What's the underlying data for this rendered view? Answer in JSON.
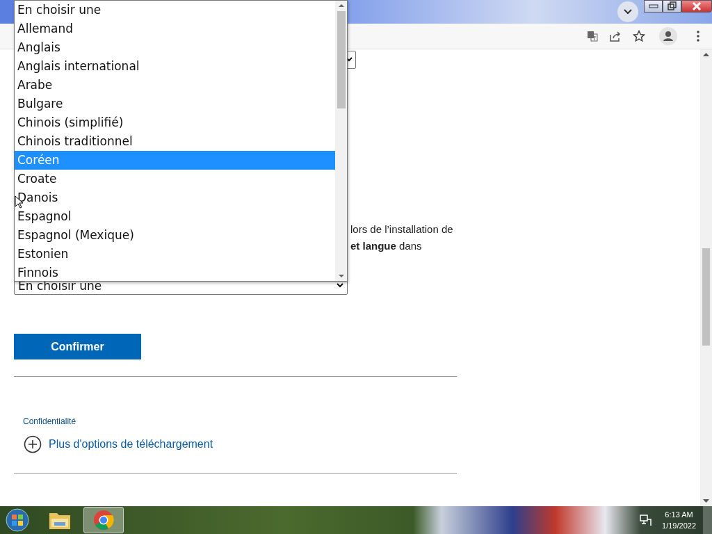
{
  "dropdown": {
    "options": [
      {
        "label": "En choisir une",
        "selected": false
      },
      {
        "label": "Allemand",
        "selected": false
      },
      {
        "label": "Anglais",
        "selected": false
      },
      {
        "label": "Anglais international",
        "selected": false
      },
      {
        "label": "Arabe",
        "selected": false
      },
      {
        "label": "Bulgare",
        "selected": false
      },
      {
        "label": "Chinois (simplifié)",
        "selected": false
      },
      {
        "label": "Chinois traditionnel",
        "selected": false
      },
      {
        "label": "Coréen",
        "selected": true
      },
      {
        "label": "Croate",
        "selected": false
      },
      {
        "label": "Danois",
        "selected": false
      },
      {
        "label": "Espagnol",
        "selected": false
      },
      {
        "label": "Espagnol (Mexique)",
        "selected": false
      },
      {
        "label": "Estonien",
        "selected": false
      },
      {
        "label": "Finnois",
        "selected": false
      }
    ]
  },
  "page": {
    "paragraph_lines": [
      "lors de l’installation de",
      "**et langue** dans"
    ],
    "language_select": {
      "value": "En choisir une"
    },
    "confirm_button": "Confirmer",
    "privacy_link": "Confidentialité",
    "more_options": "Plus d'options de téléchargement"
  },
  "taskbar": {
    "time": "6:13 AM",
    "date": "1/19/2022"
  }
}
